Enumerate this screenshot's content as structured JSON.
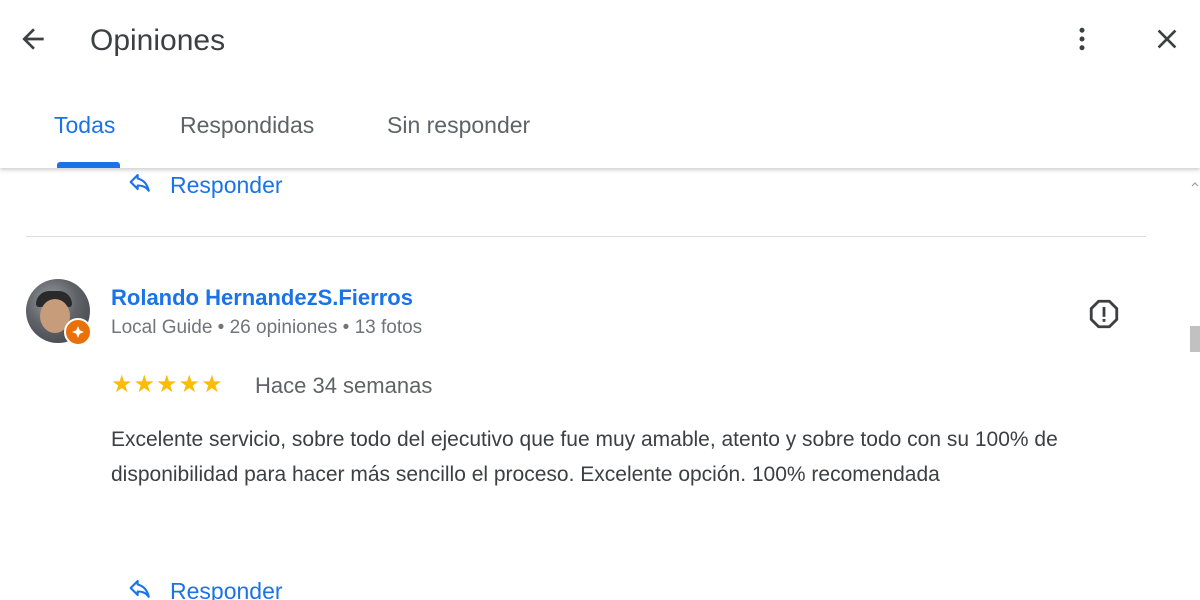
{
  "header": {
    "title": "Opiniones",
    "back_icon": "arrow-back-icon",
    "more_icon": "more-vert-icon",
    "close_icon": "close-icon"
  },
  "tabs": [
    {
      "label": "Todas",
      "active": true
    },
    {
      "label": "Respondidas",
      "active": false
    },
    {
      "label": "Sin responder",
      "active": false
    }
  ],
  "previous_review": {
    "reply_label": "Responder"
  },
  "review": {
    "author": "Rolando HernandezS.Fierros",
    "meta": "Local Guide • 26 opiniones • 13 fotos",
    "rating": 5,
    "time_ago": "Hace 34 semanas",
    "text": "Excelente servicio, sobre todo del ejecutivo que fue muy amable, atento y sobre todo con su 100% de disponibilidad para hacer más sencillo el proceso. Excelente opción. 100% recomendada",
    "reply_label": "Responder",
    "report_icon": "report-icon"
  },
  "colors": {
    "accent": "#1a73e8",
    "star": "#fbbc04",
    "badge": "#e8710a",
    "text": "#3c4043",
    "muted": "#70757a"
  }
}
